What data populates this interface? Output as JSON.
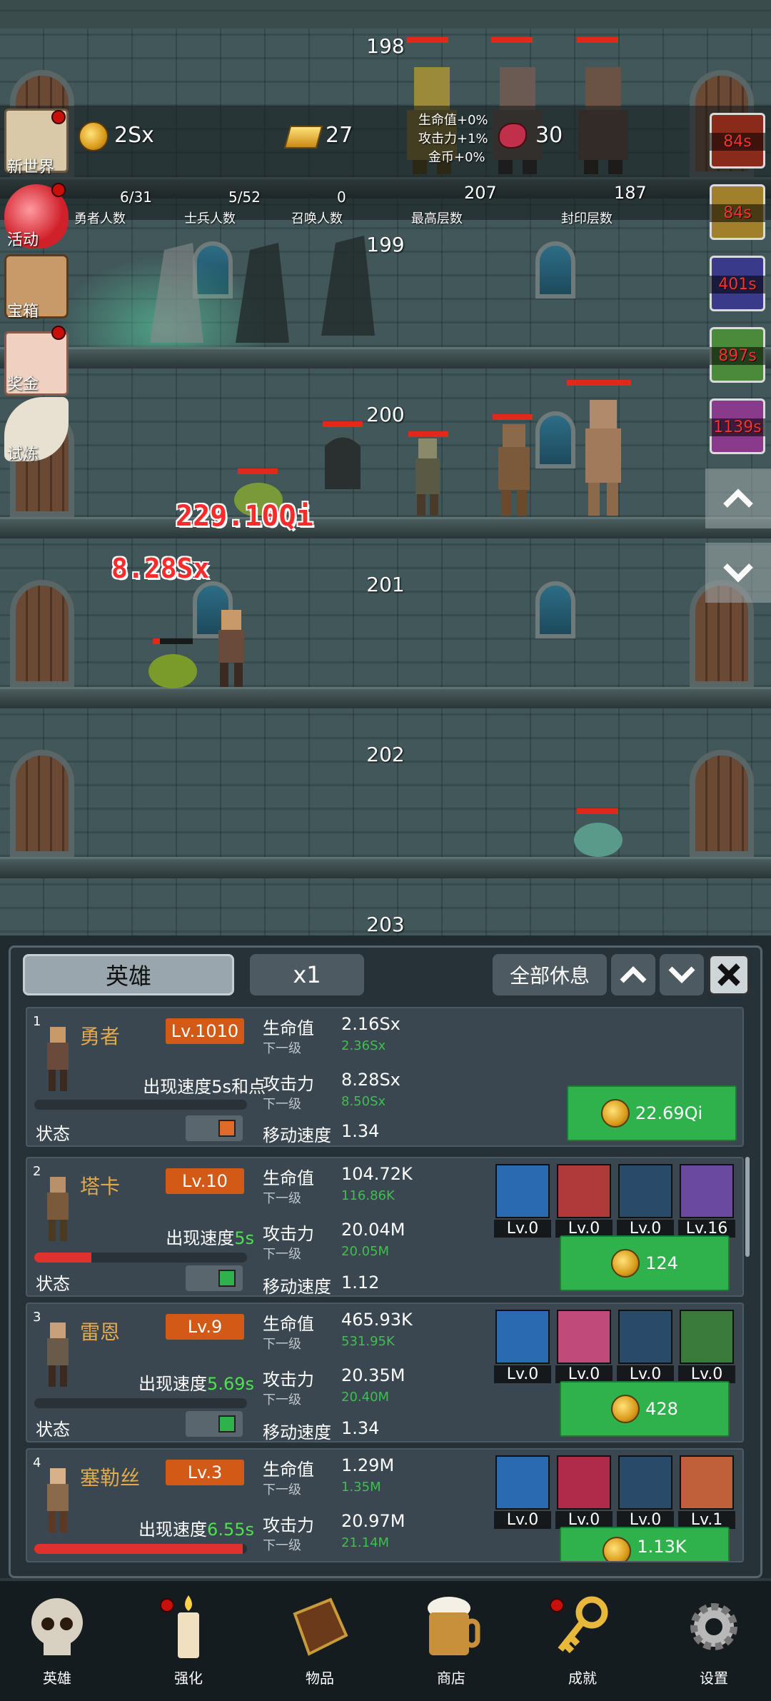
{
  "top_stats": {
    "gold": "2Sx",
    "gold_bars": "27",
    "meat": "30",
    "buff_text": [
      "生命值+0%",
      "攻击力+1%",
      "金币+0%"
    ]
  },
  "counters": [
    {
      "value": "6/31",
      "label": "勇者人数"
    },
    {
      "value": "5/52",
      "label": "士兵人数"
    },
    {
      "value": "0",
      "label": "召唤人数"
    },
    {
      "value": "207",
      "label": "最高层数"
    },
    {
      "value": "187",
      "label": "封印层数"
    }
  ],
  "side_menu": [
    {
      "label": "新世界",
      "badge": true
    },
    {
      "label": "活动",
      "badge": true
    },
    {
      "label": "宝箱",
      "badge": false
    },
    {
      "label": "奖金",
      "badge": true
    },
    {
      "label": "试炼",
      "badge": false
    }
  ],
  "timers": [
    "84s",
    "84s",
    "401s",
    "897s",
    "1139s"
  ],
  "floors": [
    "198",
    "199",
    "200",
    "201",
    "202",
    "203"
  ],
  "damage_texts": [
    "229.10Qi",
    "8.28Sx"
  ],
  "panel": {
    "title_tab": "英雄",
    "multiplier": "x1",
    "rest_all": "全部休息",
    "labels": {
      "hp": "生命值",
      "atk": "攻击力",
      "next": "下一级",
      "move": "移动速度",
      "state": "状态"
    }
  },
  "heroes": [
    {
      "idx": "1",
      "name": "勇者",
      "level": "Lv.1010",
      "spawn": "出现速度5s和点",
      "spawn_green": "",
      "hp": "2.16Sx",
      "hp_next": "2.36Sx",
      "atk": "8.28Sx",
      "atk_next": "8.50Sx",
      "move": "1.34",
      "cost": "22.69Qi",
      "bar": 0,
      "skills": []
    },
    {
      "idx": "2",
      "name": "塔卡",
      "level": "Lv.10",
      "spawn": "出现速度",
      "spawn_green": "5s",
      "hp": "104.72K",
      "hp_next": "116.86K",
      "atk": "20.04M",
      "atk_next": "20.05M",
      "move": "1.12",
      "cost": "124",
      "bar": 0.27,
      "skills": [
        "Lv.0",
        "Lv.0",
        "Lv.0",
        "Lv.16"
      ]
    },
    {
      "idx": "3",
      "name": "雷恩",
      "level": "Lv.9",
      "spawn": "出现速度",
      "spawn_green": "5.69s",
      "hp": "465.93K",
      "hp_next": "531.95K",
      "atk": "20.35M",
      "atk_next": "20.40M",
      "move": "1.34",
      "cost": "428",
      "bar": 0,
      "skills": [
        "Lv.0",
        "Lv.0",
        "Lv.0",
        "Lv.0"
      ]
    },
    {
      "idx": "4",
      "name": "塞勒丝",
      "level": "Lv.3",
      "spawn": "出现速度",
      "spawn_green": "6.55s",
      "hp": "1.29M",
      "hp_next": "1.35M",
      "atk": "20.97M",
      "atk_next": "21.14M",
      "move": "",
      "cost": "1.13K",
      "bar": 0.98,
      "skills": [
        "Lv.0",
        "Lv.0",
        "Lv.0",
        "Lv.1"
      ]
    }
  ],
  "nav": [
    {
      "label": "英雄",
      "icon": "skull-icon",
      "badge": false
    },
    {
      "label": "强化",
      "icon": "candle-icon",
      "badge": true
    },
    {
      "label": "物品",
      "icon": "book-icon",
      "badge": false
    },
    {
      "label": "商店",
      "icon": "beer-mug-icon",
      "badge": false
    },
    {
      "label": "成就",
      "icon": "key-icon",
      "badge": true
    },
    {
      "label": "设置",
      "icon": "gear-icon",
      "badge": false
    }
  ]
}
